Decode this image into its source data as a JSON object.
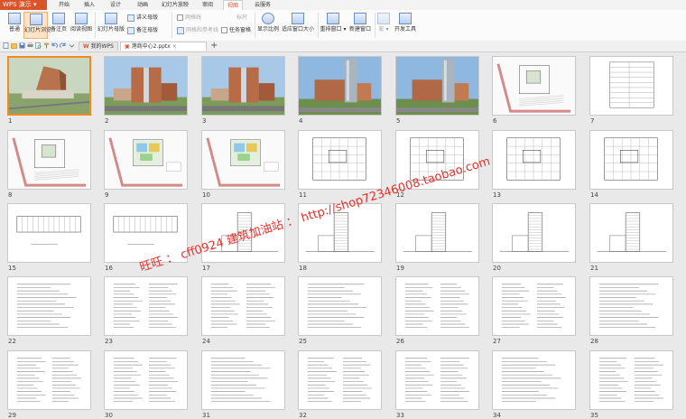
{
  "app": {
    "name": "WPS 演示"
  },
  "menu_tabs": [
    "开始",
    "插入",
    "设计",
    "动画",
    "幻灯片放映",
    "审阅",
    "视图",
    "云服务"
  ],
  "active_menu": "视图",
  "ribbon": {
    "normal": "普通",
    "slide_sorter": "幻灯片浏览",
    "notes_page": "备注页",
    "reading_view": "阅读视图",
    "slide_master": "幻灯片母版",
    "handout_master": "讲义母版",
    "notes_master": "备注母版",
    "grid": "网格线",
    "ruler": "标尺",
    "grid_settings": "网格和参考线",
    "task_pane": "任务窗格",
    "zoom": "显示比例",
    "fit_window": "适应窗口大小",
    "arrange_window": "重排窗口",
    "new_window": "新建窗口",
    "macro": "宏",
    "developer": "开发工具"
  },
  "doc_tabs": [
    "我的WPS",
    "港商中心2.pptx"
  ],
  "slides": [
    {
      "n": "1",
      "kind": "render-aerial"
    },
    {
      "n": "2",
      "kind": "render-street"
    },
    {
      "n": "3",
      "kind": "render-street"
    },
    {
      "n": "4",
      "kind": "render-tower"
    },
    {
      "n": "5",
      "kind": "render-tower"
    },
    {
      "n": "6",
      "kind": "site-plan"
    },
    {
      "n": "7",
      "kind": "table"
    },
    {
      "n": "8",
      "kind": "site-plan"
    },
    {
      "n": "9",
      "kind": "site-color"
    },
    {
      "n": "10",
      "kind": "site-color"
    },
    {
      "n": "11",
      "kind": "floor-plan"
    },
    {
      "n": "12",
      "kind": "floor-plan"
    },
    {
      "n": "13",
      "kind": "floor-plan"
    },
    {
      "n": "14",
      "kind": "floor-plan"
    },
    {
      "n": "15",
      "kind": "section"
    },
    {
      "n": "16",
      "kind": "section"
    },
    {
      "n": "17",
      "kind": "elevation"
    },
    {
      "n": "18",
      "kind": "elevation"
    },
    {
      "n": "19",
      "kind": "elevation"
    },
    {
      "n": "20",
      "kind": "elevation"
    },
    {
      "n": "21",
      "kind": "elevation"
    },
    {
      "n": "22",
      "kind": "text"
    },
    {
      "n": "23",
      "kind": "text"
    },
    {
      "n": "24",
      "kind": "text"
    },
    {
      "n": "25",
      "kind": "text"
    },
    {
      "n": "26",
      "kind": "text"
    },
    {
      "n": "27",
      "kind": "text"
    },
    {
      "n": "28",
      "kind": "text"
    },
    {
      "n": "29",
      "kind": "text"
    },
    {
      "n": "30",
      "kind": "text"
    },
    {
      "n": "31",
      "kind": "text"
    },
    {
      "n": "32",
      "kind": "text"
    },
    {
      "n": "33",
      "kind": "text"
    },
    {
      "n": "34",
      "kind": "text"
    },
    {
      "n": "35",
      "kind": "text"
    }
  ],
  "watermark": "旺旺 ： cff0924  建筑加油站 ： http://shop72346008.taobao.com",
  "colors": {
    "accent": "#d9532b",
    "selection": "#f08a24",
    "watermark": "#e3312b"
  }
}
